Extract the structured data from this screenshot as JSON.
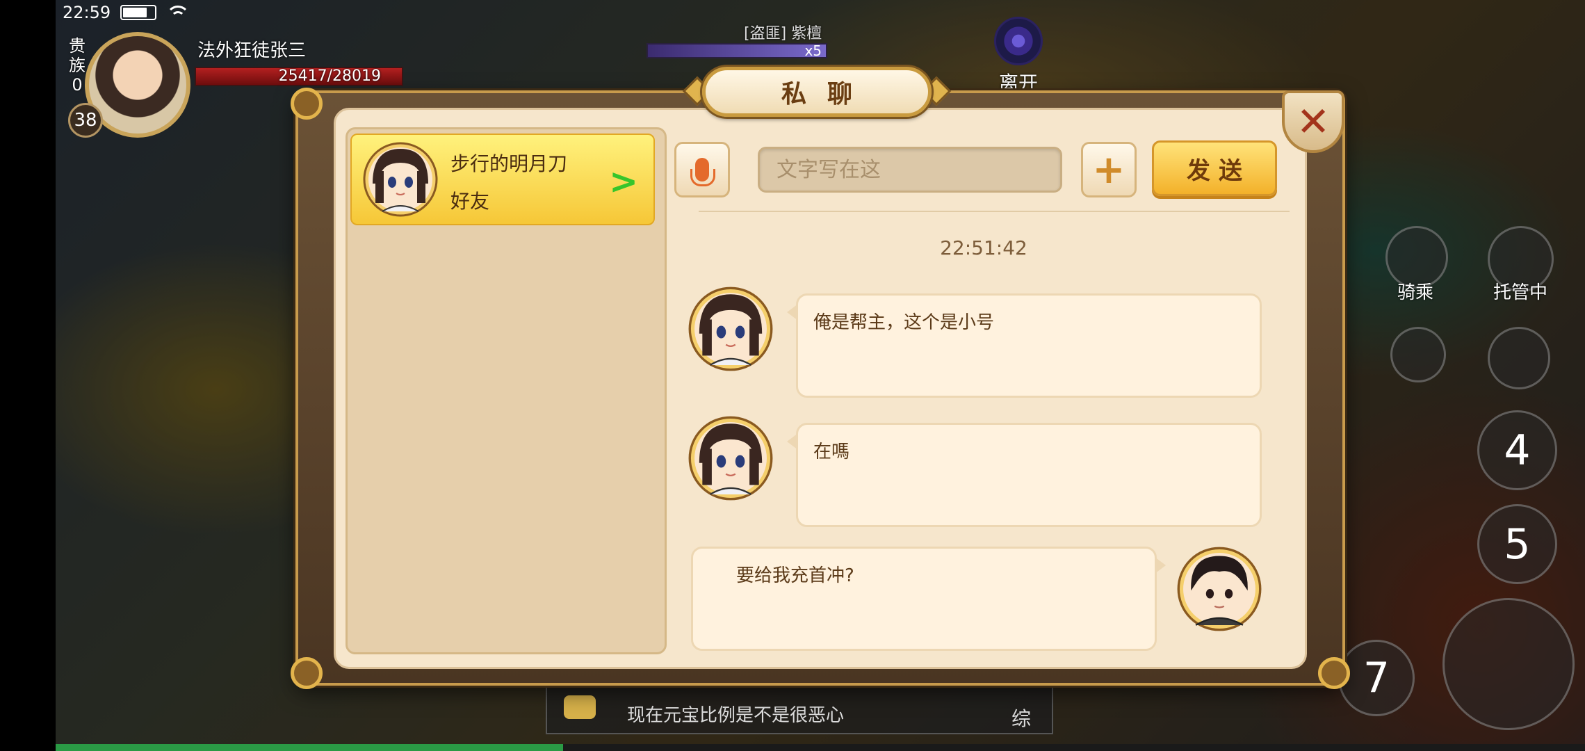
{
  "status_bar": {
    "time": "22:59"
  },
  "player": {
    "noble_label": "贵族",
    "noble_level": "0",
    "name": "法外狂徒张三",
    "hp": "25417/28019",
    "level": "38"
  },
  "enemy": {
    "name": "[盗匪] 紫檀",
    "count": "x5"
  },
  "leave_button": "离开",
  "hud": {
    "ride": "骑乘",
    "auto": "托管中",
    "skill_4": "4",
    "skill_5": "5",
    "skill_7": "7"
  },
  "bottom_chat": {
    "message": "现在元宝比例是不是很恶心",
    "zong": "综"
  },
  "dialog": {
    "title": "私聊",
    "close_symbol": "✕",
    "contacts": [
      {
        "name": "步行的明月刀",
        "tag": "好友",
        "chevron": ">"
      }
    ],
    "input": {
      "placeholder": "文字写在这",
      "value": ""
    },
    "plus_symbol": "+",
    "send_label": "发送",
    "timestamp": "22:51:42",
    "messages": [
      {
        "from": "friend",
        "text": "俺是帮主，这个是小号"
      },
      {
        "from": "friend",
        "text": "在嗎"
      },
      {
        "from": "me",
        "text": "要给我充首冲?"
      }
    ]
  },
  "colors": {
    "accent": "#f6c737",
    "panel": "#f6e6cc",
    "close": "#a3331b",
    "online": "#38c52b"
  }
}
